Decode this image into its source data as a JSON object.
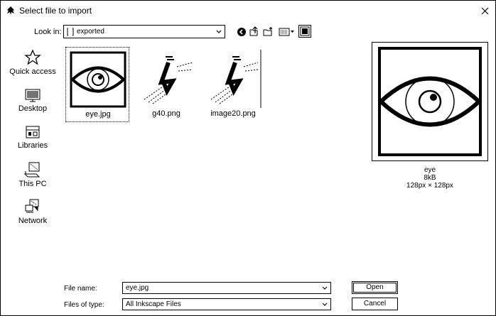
{
  "window": {
    "title": "Select file to import"
  },
  "lookin": {
    "label": "Look in:",
    "value": "exported"
  },
  "toolbar": {
    "buttons": [
      "go-back-icon",
      "up-one-level-icon",
      "new-folder-icon",
      "view-menu-icon",
      "preview-toggle-icon"
    ]
  },
  "places": [
    {
      "label": "Quick access",
      "icon": "quick-access-star-icon"
    },
    {
      "label": "Desktop",
      "icon": "desktop-icon"
    },
    {
      "label": "Libraries",
      "icon": "libraries-icon"
    },
    {
      "label": "This PC",
      "icon": "this-pc-icon"
    },
    {
      "label": "Network",
      "icon": "network-icon"
    }
  ],
  "files": [
    {
      "name": "eye.jpg",
      "selected": true
    },
    {
      "name": "g40.png",
      "selected": false
    },
    {
      "name": "image20.png",
      "selected": false
    }
  ],
  "preview": {
    "name": "eye",
    "size": "8kB",
    "dimensions": "128px × 128px"
  },
  "form": {
    "filename_label": "File name:",
    "filename_value": "eye.jpg",
    "filetype_label": "Files of type:",
    "filetype_value": "All Inkscape Files"
  },
  "buttons": {
    "open": "Open",
    "cancel": "Cancel"
  }
}
